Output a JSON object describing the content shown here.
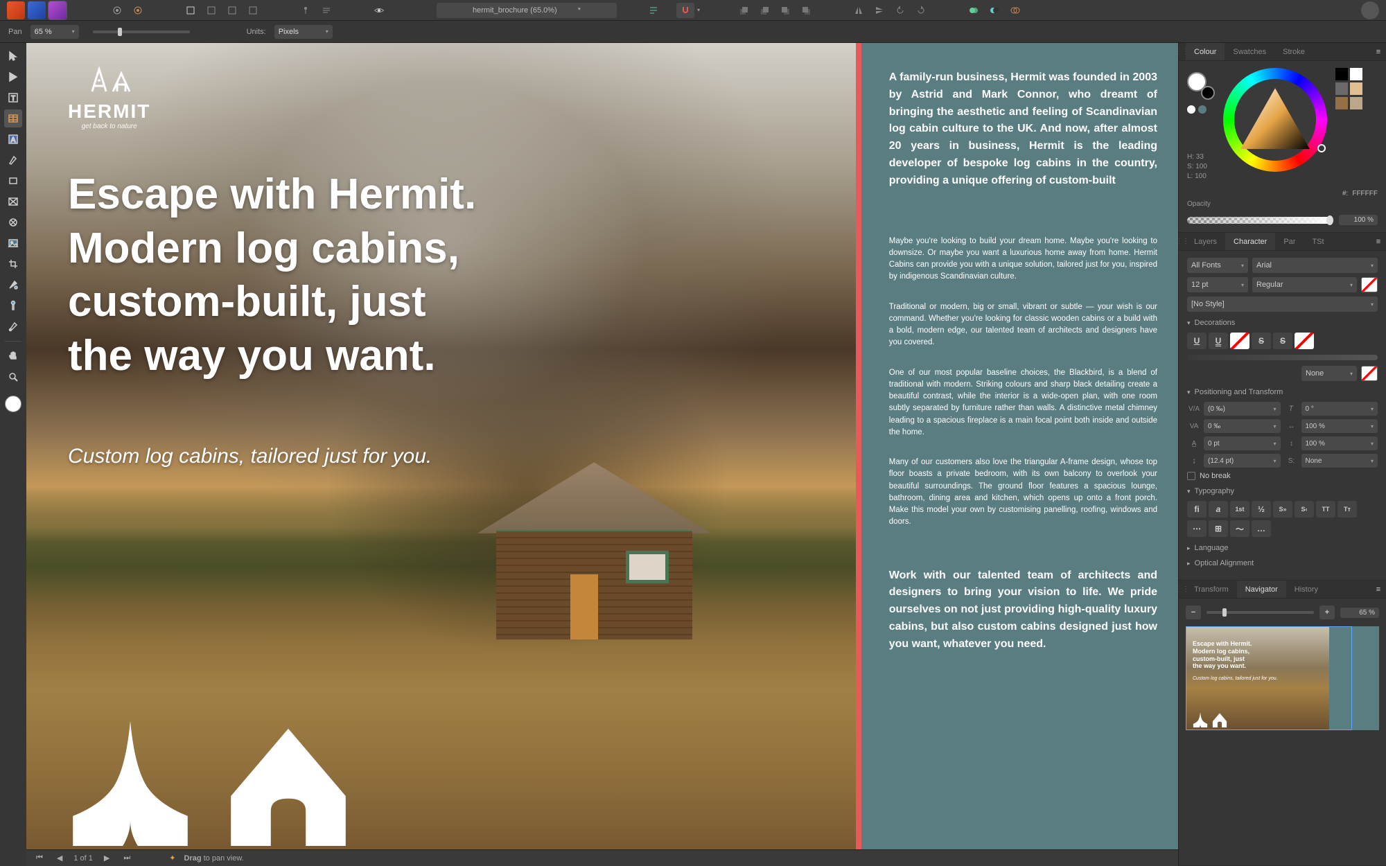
{
  "toolbar": {
    "doc_title": "hermit_brochure (65.0%)",
    "doc_dirty": "*"
  },
  "context": {
    "tool_label": "Pan",
    "zoom_value": "65 %",
    "units_label": "Units:",
    "units_value": "Pixels"
  },
  "colour": {
    "tabs": [
      "Colour",
      "Swatches",
      "Stroke"
    ],
    "h": "H: 33",
    "s": "S: 100",
    "l": "L: 100",
    "hex_prefix": "#:",
    "hex": "FFFFFF",
    "opacity_label": "Opacity",
    "opacity_value": "100 %",
    "swatches": [
      "#000000",
      "#ffffff",
      "#6a6a6a",
      "#e0c090",
      "#956f45",
      "#bba88a"
    ]
  },
  "char": {
    "tabs": [
      "Layers",
      "Character",
      "Par",
      "TSt"
    ],
    "font_collection": "All Fonts",
    "font_family": "Arial",
    "font_size": "12 pt",
    "font_weight": "Regular",
    "style": "[No Style]",
    "sections": {
      "decorations": "Decorations",
      "positioning": "Positioning and Transform",
      "typography": "Typography",
      "language": "Language",
      "optical": "Optical Alignment"
    },
    "deco_none": "None",
    "pos": {
      "tracking": "(0 ‰)",
      "kerning": "0 ‰",
      "baseline": "0 pt",
      "leading": "(12.4 pt)",
      "shear": "0 °",
      "hscale": "100 %",
      "vscale": "100 %",
      "scale_menu": "None"
    },
    "nobreak": "No break",
    "typo_labels": [
      "fi",
      "a",
      "1st",
      "½",
      "S»",
      "S‹",
      "TT",
      "Tᴛ"
    ]
  },
  "nav": {
    "tabs": [
      "Transform",
      "Navigator",
      "History"
    ],
    "zoom": "65 %",
    "preview_headline_1": "Escape with Hermit.",
    "preview_headline_2": "Modern log cabins,",
    "preview_headline_3": "custom-built, just",
    "preview_headline_4": "the way you want.",
    "preview_sub_line": "Custom log cabins, tailored just for you."
  },
  "status": {
    "page": "1 of 1",
    "hint_bold": "Drag",
    "hint_rest": " to pan view."
  },
  "hero": {
    "brand": "HERMIT",
    "tag": "get back to nature",
    "headline_l1": "Escape with Hermit.",
    "headline_l2": "Modern log cabins,",
    "headline_l3": "custom-built, just",
    "headline_l4": "the way you want.",
    "sub": "Custom log cabins, tailored just for you."
  },
  "body": {
    "p1": "A family-run business, Hermit was founded in 2003 by Astrid and Mark Connor, who dreamt of bringing the aesthetic and feeling of Scandinavian log cabin culture to the UK. And now, after almost 20 years in business, Hermit is the leading developer of bespoke log cabins in the country, providing a unique offering of custom-built",
    "p2": "Maybe you're looking to build your dream home. Maybe you're looking to downsize. Or maybe you want a luxurious home away from home. Hermit Cabins can provide you with a unique solution, tailored just for you, inspired by indigenous Scandinavian culture.",
    "p3": "Traditional or modern, big or small, vibrant or subtle — your wish is our command. Whether you're looking for classic wooden cabins or a build with a bold, modern edge, our talented team of architects and designers have you covered.",
    "p4": "One of our most popular baseline choices, the Blackbird, is a blend of traditional with modern. Striking colours and sharp black detailing create a beautiful contrast, while the interior is a wide-open plan, with one room subtly separated by furniture rather than walls. A distinctive metal chimney leading to a spacious fireplace is a main focal point both inside and outside the home.",
    "p5": "Many of our customers also love the triangular A-frame design, whose top floor boasts a private bedroom, with its own balcony to overlook your beautiful surroundings. The ground floor features a spacious lounge, bathroom, dining area and kitchen, which opens up onto a front porch. Make this model your own by customising panelling, roofing, windows and doors.",
    "p6": "Work with our talented team of architects and designers to bring your vision to life. We pride ourselves on not just providing high-quality luxury cabins, but also custom cabins designed just how you want, whatever you need."
  }
}
